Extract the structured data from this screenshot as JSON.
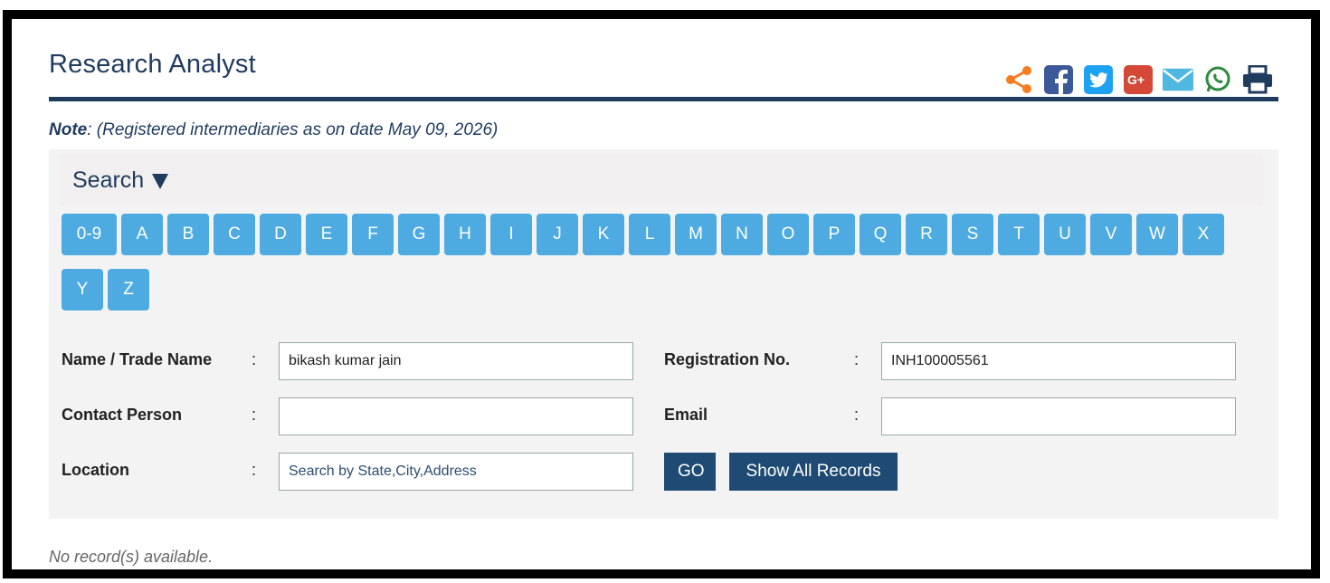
{
  "page": {
    "title": "Research Analyst"
  },
  "social": [
    "share-icon",
    "facebook-icon",
    "twitter-icon",
    "google-plus-icon",
    "email-icon",
    "whatsapp-icon",
    "print-icon"
  ],
  "colors": {
    "brand": "#1f3b5e",
    "letter_button": "#4eabe2",
    "action_button": "#1f4a74",
    "share": "#f57c20",
    "facebook": "#3b5998",
    "twitter": "#1da1f2",
    "googleplus": "#d34836",
    "email": "#4fb8e0",
    "whatsapp": "#2e8b3d"
  },
  "note": {
    "label": "Note",
    "text": ": (Registered intermediaries as on date May 09, 2026)"
  },
  "search": {
    "title": "Search",
    "letters": [
      "0-9",
      "A",
      "B",
      "C",
      "D",
      "E",
      "F",
      "G",
      "H",
      "I",
      "J",
      "K",
      "L",
      "M",
      "N",
      "O",
      "P",
      "Q",
      "R",
      "S",
      "T",
      "U",
      "V",
      "W",
      "X",
      "Y",
      "Z"
    ],
    "fields": {
      "name": {
        "label": "Name / Trade Name",
        "value": "bikash kumar jain"
      },
      "registration": {
        "label": "Registration No.",
        "value": "INH100005561"
      },
      "contact": {
        "label": "Contact Person",
        "value": ""
      },
      "email": {
        "label": "Email",
        "value": ""
      },
      "location": {
        "label": "Location",
        "placeholder": "Search by State,City,Address",
        "value": ""
      }
    },
    "colon": ":",
    "go_label": "GO",
    "show_all_label": "Show All Records"
  },
  "results": {
    "empty_text": "No record(s) available."
  }
}
